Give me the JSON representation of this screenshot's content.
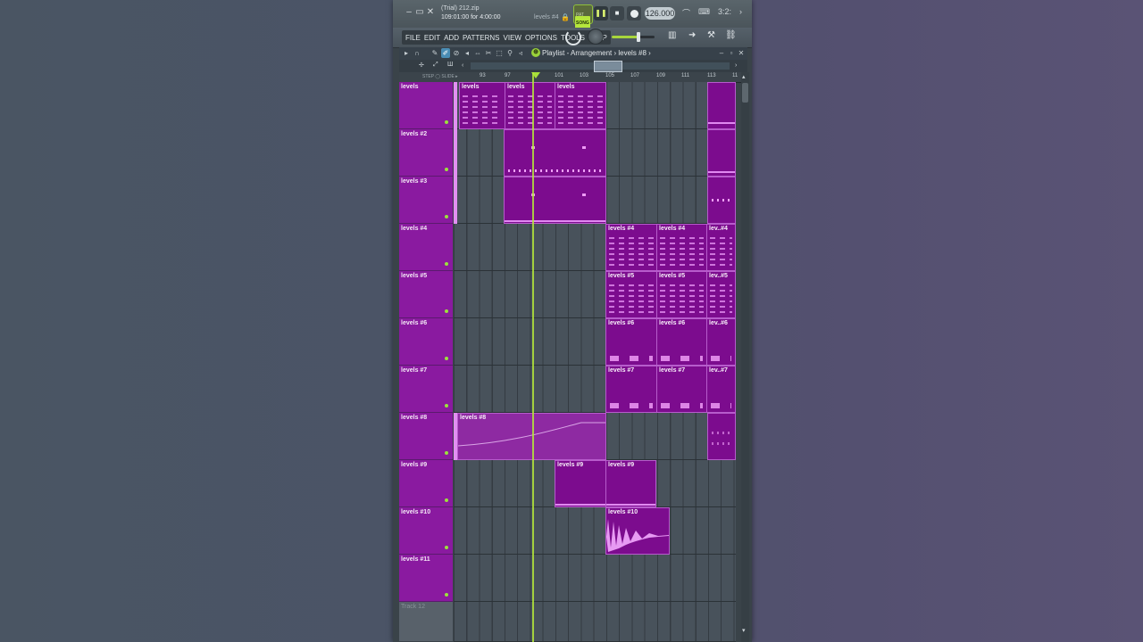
{
  "window": {
    "project_title": "(Trial) 212.zip",
    "project_time": "109:01:00 for 4:00:00",
    "current_pattern": "levels #4",
    "win_buttons": [
      "–",
      "▭",
      "✕"
    ]
  },
  "transport": {
    "song_label": "SONG",
    "pattern_label": "PAT",
    "play_icon": "pause-icon",
    "tempo": "126.000",
    "time_sig": "3:2:"
  },
  "menu": {
    "items": [
      "FILE",
      "EDIT",
      "ADD",
      "PATTERNS",
      "VIEW",
      "OPTIONS",
      "TOOLS",
      "HELP"
    ],
    "master_volume": 0.62
  },
  "playlist": {
    "title": "Playlist - Arrangement › levels #8 ›",
    "step_label": "STEP",
    "slide_label": "SLIDE",
    "ruler": [
      "93",
      "97",
      "101",
      "103",
      "105",
      "107",
      "109",
      "111",
      "113",
      "11"
    ],
    "tracks": [
      {
        "name": "levels"
      },
      {
        "name": "levels #2"
      },
      {
        "name": "levels #3"
      },
      {
        "name": "levels #4"
      },
      {
        "name": "levels #5"
      },
      {
        "name": "levels #6"
      },
      {
        "name": "levels #7"
      },
      {
        "name": "levels #8"
      },
      {
        "name": "levels #9"
      },
      {
        "name": "levels #10"
      },
      {
        "name": "levels #11"
      },
      {
        "name": "Track 12"
      }
    ],
    "clips": {
      "t1": [
        "levels",
        "levels",
        "levels"
      ],
      "t4": [
        "levels #4",
        "levels #4",
        "lev..#4"
      ],
      "t5": [
        "levels #5",
        "levels #5",
        "lev..#5"
      ],
      "t6": [
        "levels #6",
        "levels #6",
        "lev..#6"
      ],
      "t7": [
        "levels #7",
        "levels #7",
        "lev..#7"
      ],
      "t8": "levels #8",
      "t9": [
        "levels #9",
        "levels #9"
      ],
      "t10": "levels #10"
    }
  },
  "colors": {
    "clip": "#7c0c8e",
    "track_header": "#8a1aa0",
    "playhead": "#b5e83a"
  }
}
